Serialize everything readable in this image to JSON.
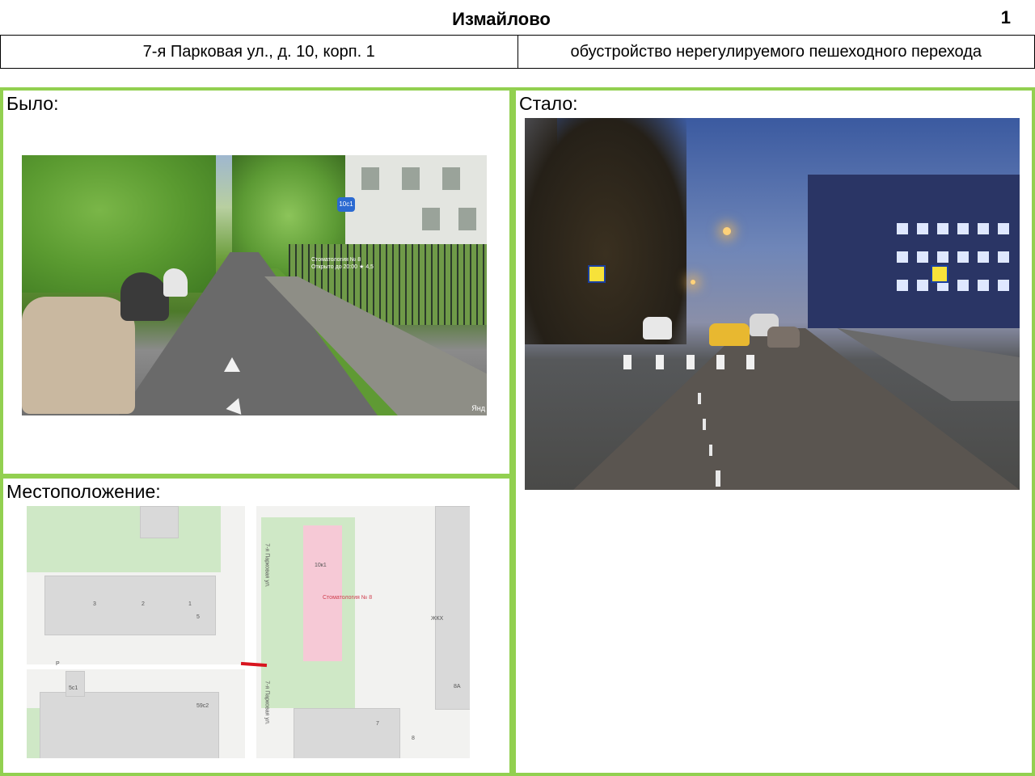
{
  "header": {
    "title": "Измайлово",
    "page_number": "1"
  },
  "info": {
    "address": "7-я Парковая ул., д. 10, корп. 1",
    "description": "обустройство нерегулируемого пешеходного  перехода"
  },
  "panels": {
    "before_label": "Было:",
    "after_label": "Стало:",
    "location_label": "Местоположение:"
  },
  "before_photo": {
    "sign_text": "10с1",
    "poi_text": "Стоматология № 8",
    "poi_hours": "Открыто до 20:00 ★ 4,5",
    "watermark": "Янд"
  },
  "map": {
    "street_label_top": "7-я Парковая ул.",
    "street_label_bottom": "7-я Парковая ул.",
    "building_10k1": "10к1",
    "poi_dentistry": "Стоматология № 8",
    "house_3": "3",
    "house_2": "2",
    "house_1": "1",
    "house_5": "5",
    "house_5c1": "5с1",
    "house_59c2": "59с2",
    "house_8a": "8А",
    "house_7": "7",
    "house_8": "8",
    "zhkh": "ЖКХ",
    "parking": "P"
  },
  "colors": {
    "panel_border": "#92d050",
    "crossing_marker": "#d8141e"
  }
}
